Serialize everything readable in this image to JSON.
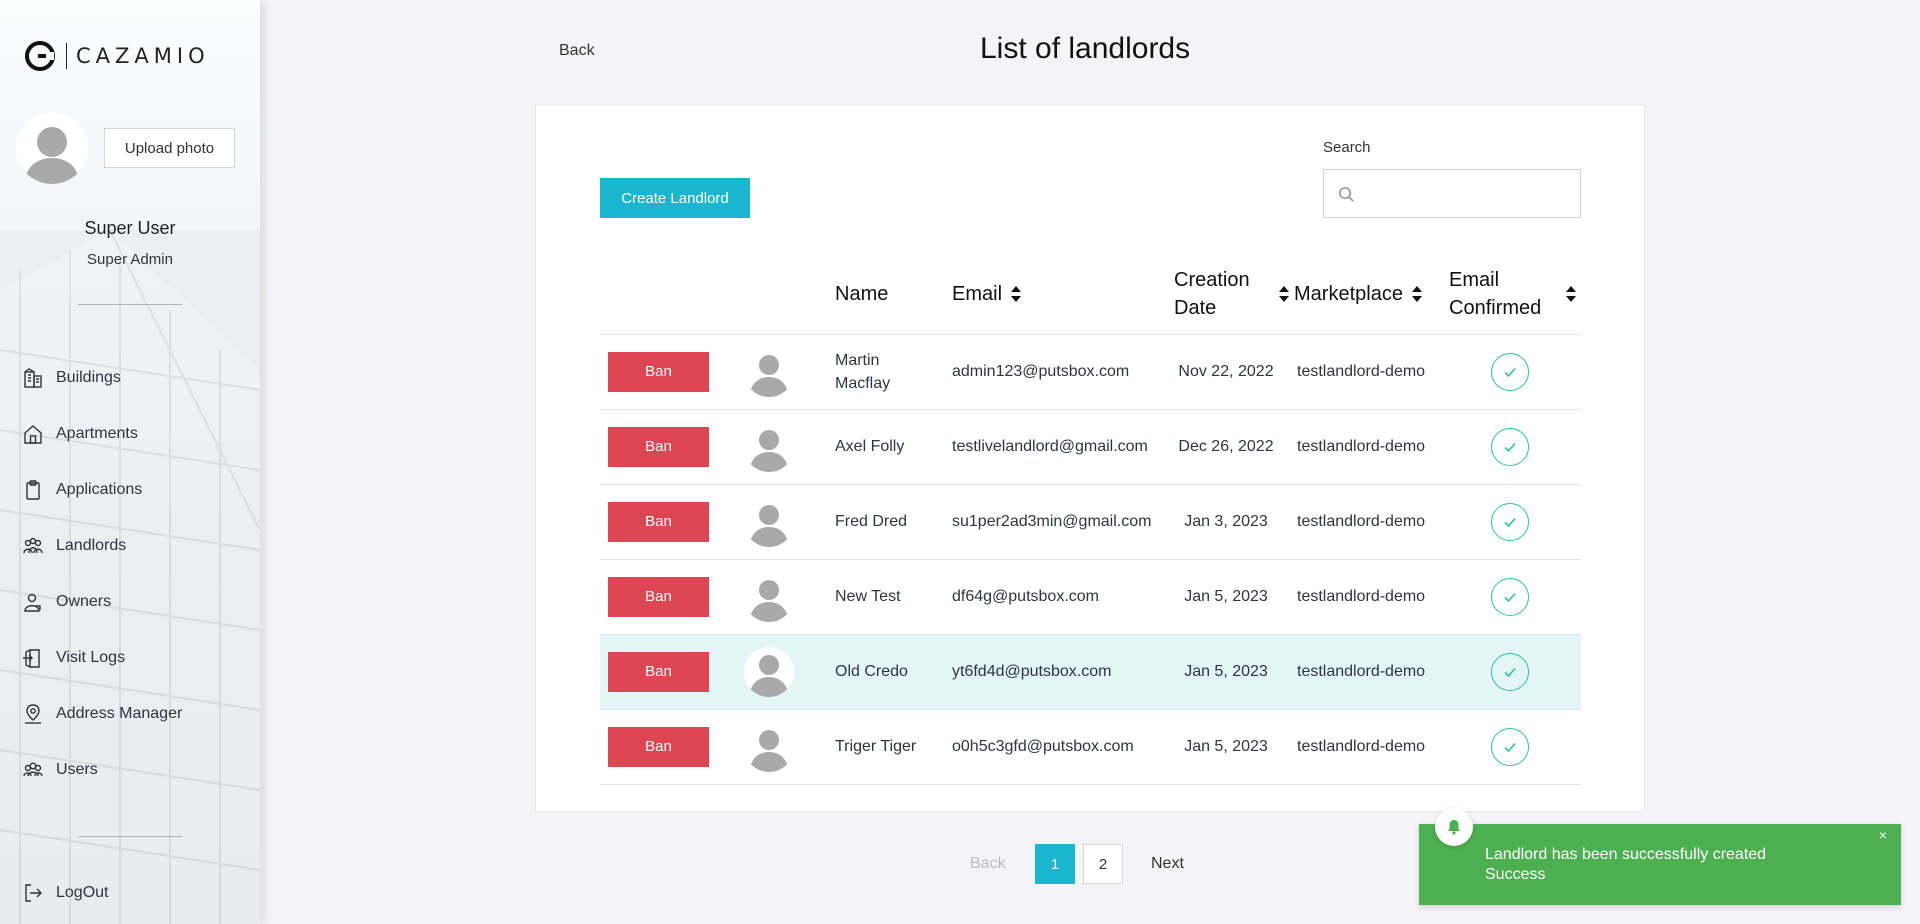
{
  "app": {
    "logo_text": "CAZAMIO"
  },
  "sidebar": {
    "upload_photo": "Upload photo",
    "user_name": "Super User",
    "user_role": "Super Admin",
    "items": [
      {
        "label": "Buildings",
        "icon": "building-icon"
      },
      {
        "label": "Apartments",
        "icon": "home-icon"
      },
      {
        "label": "Applications",
        "icon": "clipboard-icon"
      },
      {
        "label": "Landlords",
        "icon": "people-group-icon"
      },
      {
        "label": "Owners",
        "icon": "owner-icon"
      },
      {
        "label": "Visit Logs",
        "icon": "door-icon"
      },
      {
        "label": "Address Manager",
        "icon": "location-pin-icon"
      },
      {
        "label": "Users",
        "icon": "users-icon"
      }
    ],
    "logout": "LogOut"
  },
  "header": {
    "back": "Back",
    "title": "List of landlords"
  },
  "toolbar": {
    "create_label": "Create Landlord",
    "search_label": "Search",
    "search_value": ""
  },
  "table": {
    "columns": [
      "Name",
      "Email",
      "Creation Date",
      "Marketplace",
      "Email Confirmed"
    ],
    "ban_label": "Ban",
    "rows": [
      {
        "name": "Martin Macflay",
        "email": "admin123@putsbox.com",
        "date": "Nov 22, 2022",
        "marketplace": "testlandlord-demo",
        "confirmed": true
      },
      {
        "name": "Axel Folly",
        "email": "testlivelandlord@gmail.com",
        "date": "Dec 26, 2022",
        "marketplace": "testlandlord-demo",
        "confirmed": true
      },
      {
        "name": "Fred Dred",
        "email": "su1per2ad3min@gmail.com",
        "date": "Jan 3, 2023",
        "marketplace": "testlandlord-demo",
        "confirmed": true
      },
      {
        "name": "New Test",
        "email": "df64g@putsbox.com",
        "date": "Jan 5, 2023",
        "marketplace": "testlandlord-demo",
        "confirmed": true
      },
      {
        "name": "Old Credo",
        "email": "yt6fd4d@putsbox.com",
        "date": "Jan 5, 2023",
        "marketplace": "testlandlord-demo",
        "confirmed": true
      },
      {
        "name": "Triger Tiger",
        "email": "o0h5c3gfd@putsbox.com",
        "date": "Jan 5, 2023",
        "marketplace": "testlandlord-demo",
        "confirmed": true
      }
    ]
  },
  "pagination": {
    "back": "Back",
    "pages": [
      "1",
      "2"
    ],
    "current": "1",
    "next": "Next"
  },
  "toast": {
    "line1": "Landlord has been successfully created",
    "line2": "Success",
    "close": "×"
  },
  "colors": {
    "accent": "#1ab6cf",
    "danger": "#dd4652",
    "success": "#4caf50",
    "check": "#2bc39a",
    "row_highlight": "#e3f5f6"
  }
}
